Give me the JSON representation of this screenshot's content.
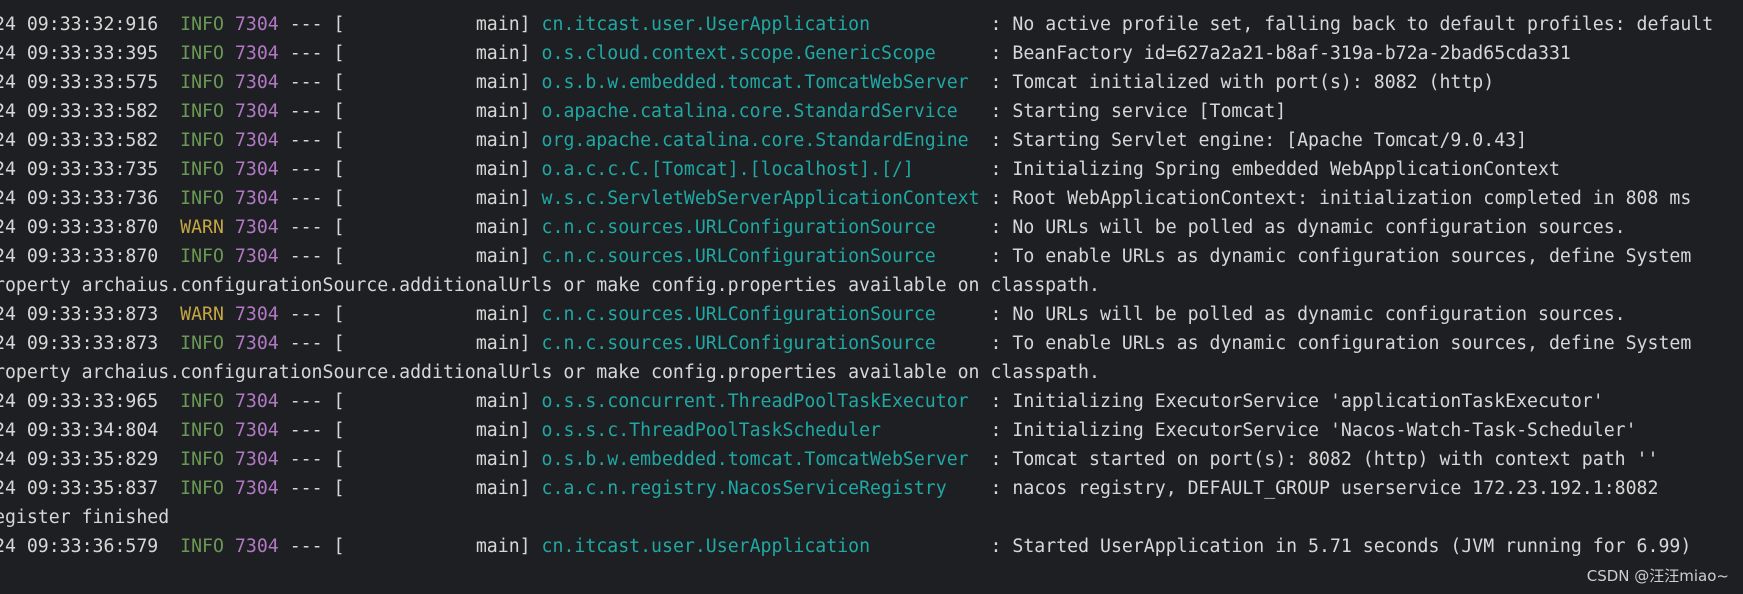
{
  "colors": {
    "background": "#1e1f22",
    "text": "#d7d7d7",
    "info": "#6a9955",
    "warn": "#c5a642",
    "pid": "#b179c4",
    "logger": "#1fa8a4"
  },
  "log_lines": [
    {
      "type": "entry",
      "ts": "24 09:33:32:916",
      "level": "INFO",
      "pid": "7304",
      "sep": "--- [",
      "thread": "main]",
      "logger": "cn.itcast.user.UserApplication",
      "message": ": No active profile set, falling back to default profiles: default"
    },
    {
      "type": "entry",
      "ts": "24 09:33:33:395",
      "level": "INFO",
      "pid": "7304",
      "sep": "--- [",
      "thread": "main]",
      "logger": "o.s.cloud.context.scope.GenericScope",
      "message": ": BeanFactory id=627a2a21-b8af-319a-b72a-2bad65cda331"
    },
    {
      "type": "entry",
      "ts": "24 09:33:33:575",
      "level": "INFO",
      "pid": "7304",
      "sep": "--- [",
      "thread": "main]",
      "logger": "o.s.b.w.embedded.tomcat.TomcatWebServer",
      "message": ": Tomcat initialized with port(s): 8082 (http)"
    },
    {
      "type": "entry",
      "ts": "24 09:33:33:582",
      "level": "INFO",
      "pid": "7304",
      "sep": "--- [",
      "thread": "main]",
      "logger": "o.apache.catalina.core.StandardService",
      "message": ": Starting service [Tomcat]"
    },
    {
      "type": "entry",
      "ts": "24 09:33:33:582",
      "level": "INFO",
      "pid": "7304",
      "sep": "--- [",
      "thread": "main]",
      "logger": "org.apache.catalina.core.StandardEngine",
      "message": ": Starting Servlet engine: [Apache Tomcat/9.0.43]"
    },
    {
      "type": "entry",
      "ts": "24 09:33:33:735",
      "level": "INFO",
      "pid": "7304",
      "sep": "--- [",
      "thread": "main]",
      "logger": "o.a.c.c.C.[Tomcat].[localhost].[/]",
      "message": ": Initializing Spring embedded WebApplicationContext"
    },
    {
      "type": "entry",
      "ts": "24 09:33:33:736",
      "level": "INFO",
      "pid": "7304",
      "sep": "--- [",
      "thread": "main]",
      "logger": "w.s.c.ServletWebServerApplicationContext",
      "message": ": Root WebApplicationContext: initialization completed in 808 ms"
    },
    {
      "type": "entry",
      "ts": "24 09:33:33:870",
      "level": "WARN",
      "pid": "7304",
      "sep": "--- [",
      "thread": "main]",
      "logger": "c.n.c.sources.URLConfigurationSource",
      "message": ": No URLs will be polled as dynamic configuration sources."
    },
    {
      "type": "entry",
      "ts": "24 09:33:33:870",
      "level": "INFO",
      "pid": "7304",
      "sep": "--- [",
      "thread": "main]",
      "logger": "c.n.c.sources.URLConfigurationSource",
      "message": ": To enable URLs as dynamic configuration sources, define System"
    },
    {
      "type": "cont",
      "text": "roperty archaius.configurationSource.additionalUrls or make config.properties available on classpath."
    },
    {
      "type": "entry",
      "ts": "24 09:33:33:873",
      "level": "WARN",
      "pid": "7304",
      "sep": "--- [",
      "thread": "main]",
      "logger": "c.n.c.sources.URLConfigurationSource",
      "message": ": No URLs will be polled as dynamic configuration sources."
    },
    {
      "type": "entry",
      "ts": "24 09:33:33:873",
      "level": "INFO",
      "pid": "7304",
      "sep": "--- [",
      "thread": "main]",
      "logger": "c.n.c.sources.URLConfigurationSource",
      "message": ": To enable URLs as dynamic configuration sources, define System"
    },
    {
      "type": "cont",
      "text": "roperty archaius.configurationSource.additionalUrls or make config.properties available on classpath."
    },
    {
      "type": "entry",
      "ts": "24 09:33:33:965",
      "level": "INFO",
      "pid": "7304",
      "sep": "--- [",
      "thread": "main]",
      "logger": "o.s.s.concurrent.ThreadPoolTaskExecutor",
      "message": ": Initializing ExecutorService 'applicationTaskExecutor'"
    },
    {
      "type": "entry",
      "ts": "24 09:33:34:804",
      "level": "INFO",
      "pid": "7304",
      "sep": "--- [",
      "thread": "main]",
      "logger": "o.s.s.c.ThreadPoolTaskScheduler",
      "message": ": Initializing ExecutorService 'Nacos-Watch-Task-Scheduler'"
    },
    {
      "type": "entry",
      "ts": "24 09:33:35:829",
      "level": "INFO",
      "pid": "7304",
      "sep": "--- [",
      "thread": "main]",
      "logger": "o.s.b.w.embedded.tomcat.TomcatWebServer",
      "message": ": Tomcat started on port(s): 8082 (http) with context path ''"
    },
    {
      "type": "entry",
      "ts": "24 09:33:35:837",
      "level": "INFO",
      "pid": "7304",
      "sep": "--- [",
      "thread": "main]",
      "logger": "c.a.c.n.registry.NacosServiceRegistry",
      "message": ": nacos registry, DEFAULT_GROUP userservice 172.23.192.1:8082"
    },
    {
      "type": "cont",
      "text": "egister finished"
    },
    {
      "type": "entry",
      "ts": "24 09:33:36:579",
      "level": "INFO",
      "pid": "7304",
      "sep": "--- [",
      "thread": "main]",
      "logger": "cn.itcast.user.UserApplication",
      "message": ": Started UserApplication in 5.71 seconds (JVM running for 6.99)"
    }
  ],
  "watermark": "CSDN @汪汪miao~"
}
